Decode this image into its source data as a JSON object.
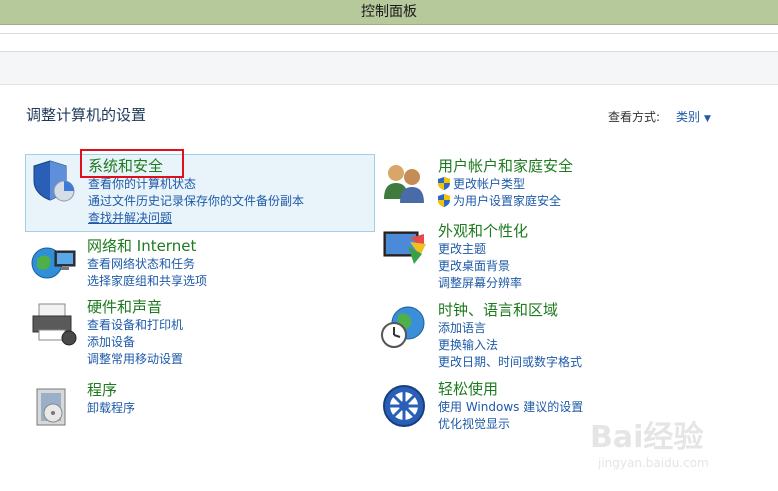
{
  "window": {
    "title": "控制面板"
  },
  "header": {
    "page_title": "调整计算机的设置",
    "view_label": "查看方式:",
    "view_value": "类别"
  },
  "categories": [
    {
      "title": "系统和安全",
      "icon": "system-security-icon",
      "links": [
        {
          "text": "查看你的计算机状态"
        },
        {
          "text": "通过文件历史记录保存你的文件备份副本"
        },
        {
          "text": "查找并解决问题"
        }
      ]
    },
    {
      "title": "网络和 Internet",
      "icon": "network-internet-icon",
      "links": [
        {
          "text": "查看网络状态和任务"
        },
        {
          "text": "选择家庭组和共享选项"
        }
      ]
    },
    {
      "title": "硬件和声音",
      "icon": "hardware-sound-icon",
      "links": [
        {
          "text": "查看设备和打印机"
        },
        {
          "text": "添加设备"
        },
        {
          "text": "调整常用移动设置"
        }
      ]
    },
    {
      "title": "程序",
      "icon": "programs-icon",
      "links": [
        {
          "text": "卸载程序"
        }
      ]
    },
    {
      "title": "用户帐户和家庭安全",
      "icon": "user-accounts-icon",
      "links": [
        {
          "text": "更改帐户类型",
          "shield": true
        },
        {
          "text": "为用户设置家庭安全",
          "shield": true
        }
      ]
    },
    {
      "title": "外观和个性化",
      "icon": "appearance-icon",
      "links": [
        {
          "text": "更改主题"
        },
        {
          "text": "更改桌面背景"
        },
        {
          "text": "调整屏幕分辨率"
        }
      ]
    },
    {
      "title": "时钟、语言和区域",
      "icon": "clock-globe-icon",
      "links": [
        {
          "text": "添加语言"
        },
        {
          "text": "更换输入法"
        },
        {
          "text": "更改日期、时间或数字格式"
        }
      ]
    },
    {
      "title": "轻松使用",
      "icon": "ease-of-access-icon",
      "links": [
        {
          "text": "使用 Windows 建议的设置"
        },
        {
          "text": "优化视觉显示"
        }
      ]
    }
  ],
  "watermark": {
    "brand": "Bai经验",
    "url": "jingyan.baidu.com"
  },
  "colors": {
    "titlebar": "#b5c99b",
    "category_title": "#1e7a1e",
    "link": "#1e5aa8",
    "highlight_border": "#9fd0ec",
    "annotation": "#e0101b"
  }
}
